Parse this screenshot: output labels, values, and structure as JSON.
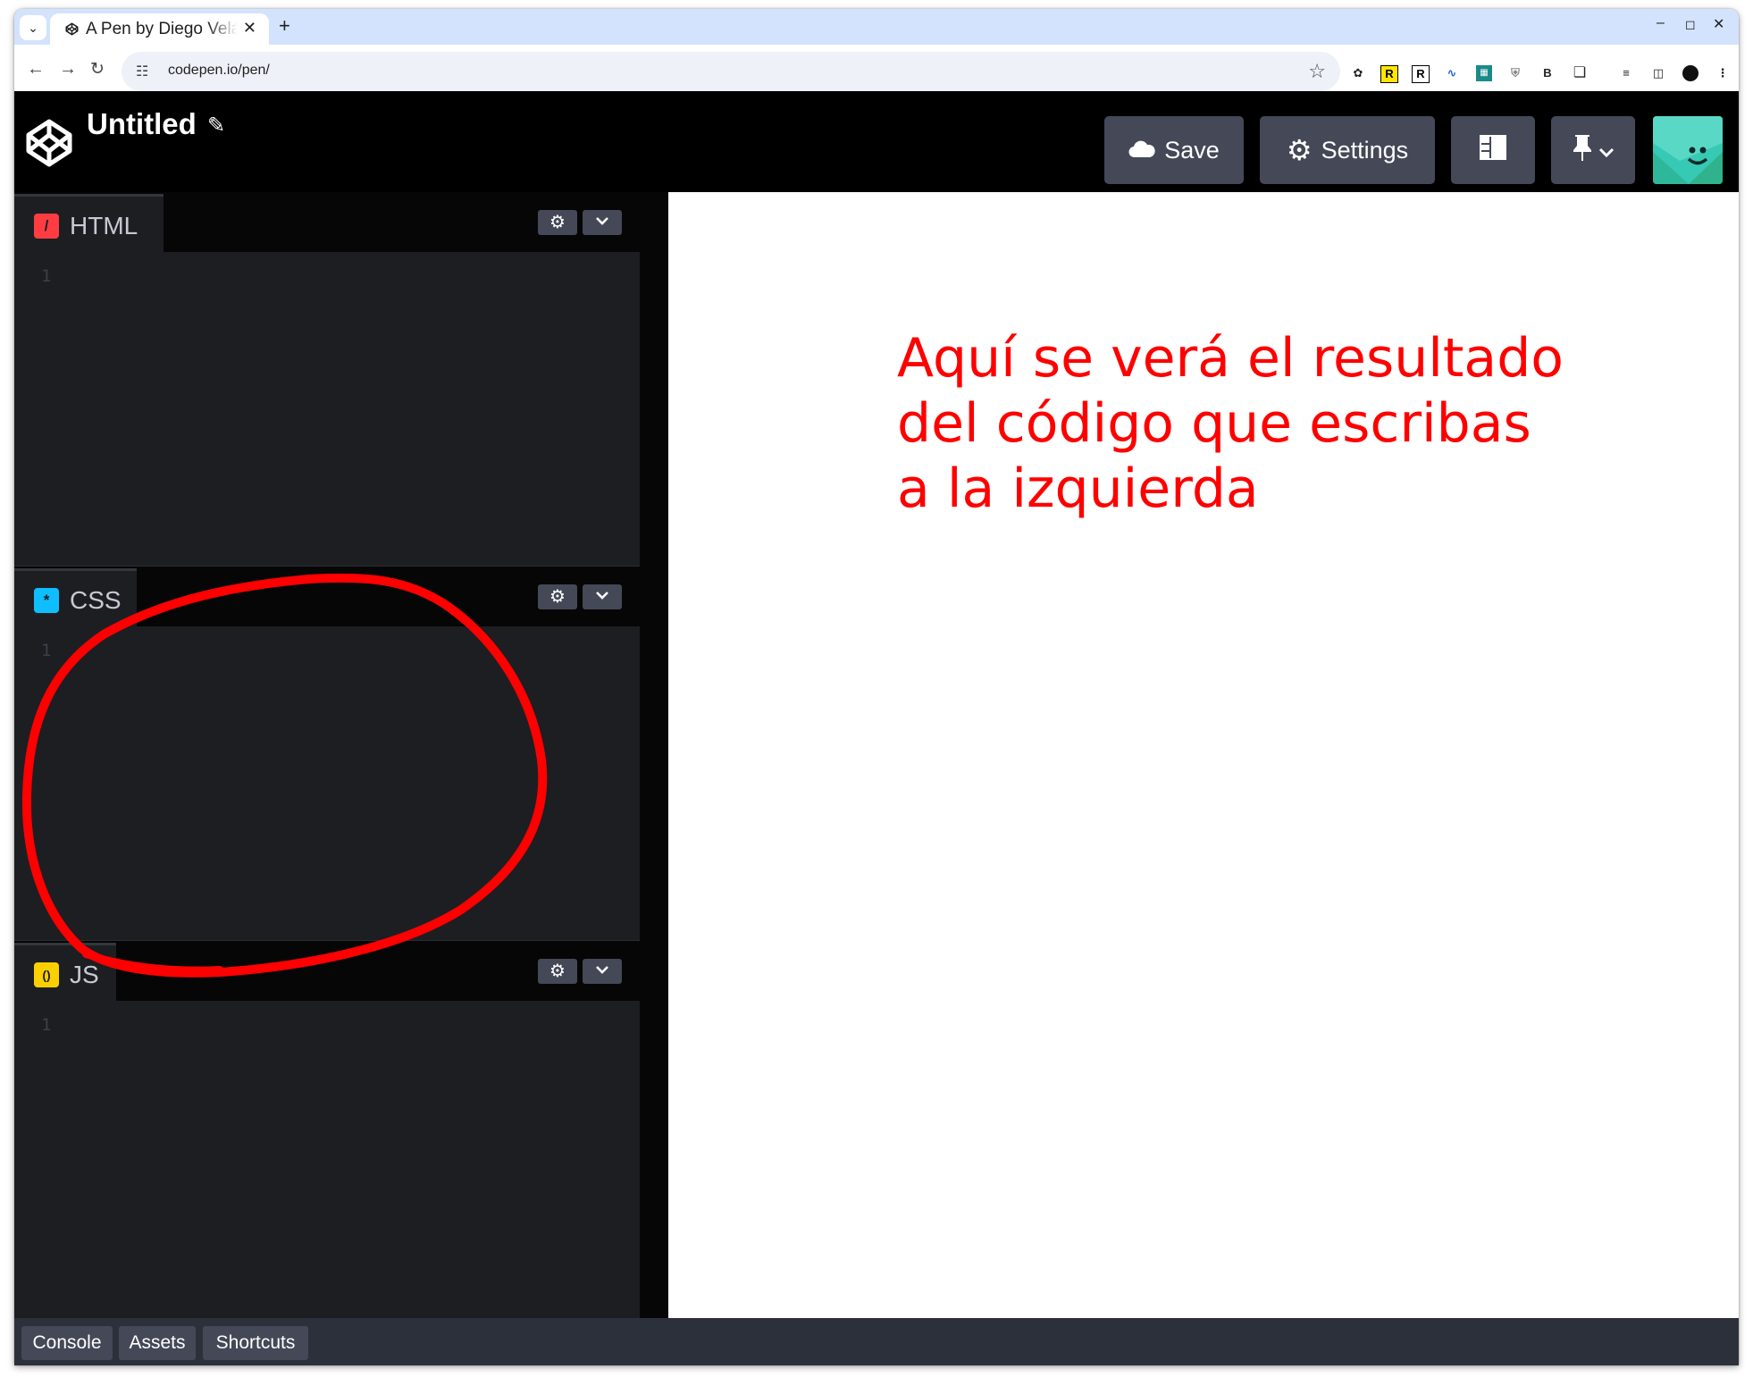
{
  "browser": {
    "tab_title": "A Pen by Diego Velázquez",
    "url": "codepen.io/pen/",
    "icons": [
      "tab-search-icon",
      "close-icon",
      "new-tab-icon",
      "minimize-icon",
      "maximize-icon",
      "window-close-icon",
      "back-icon",
      "forward-icon",
      "reload-icon",
      "site-settings-icon",
      "bookmark-star-icon",
      "extensions-icon",
      "menu-icon"
    ]
  },
  "header": {
    "title": "Untitled",
    "buttons": {
      "save": "Save",
      "settings": "Settings"
    }
  },
  "editors": [
    {
      "lang": "HTML",
      "line": "1",
      "color": "#ff3c41",
      "icon_glyph": "/"
    },
    {
      "lang": "CSS",
      "line": "1",
      "color": "#0ebeff",
      "icon_glyph": "*"
    },
    {
      "lang": "JS",
      "line": "1",
      "color": "#fcd000",
      "icon_glyph": "()"
    }
  ],
  "result": {
    "lines": [
      "Aquí se verá el resultado",
      "del código que escribas",
      "a la izquierda"
    ],
    "color": "#ff0000"
  },
  "footer": {
    "buttons": [
      "Console",
      "Assets",
      "Shortcuts"
    ]
  },
  "colors": {
    "header_bg": "#000000",
    "editor_bg": "#1d1e22",
    "button_bg": "#444857",
    "annotation": "#ff0000"
  }
}
